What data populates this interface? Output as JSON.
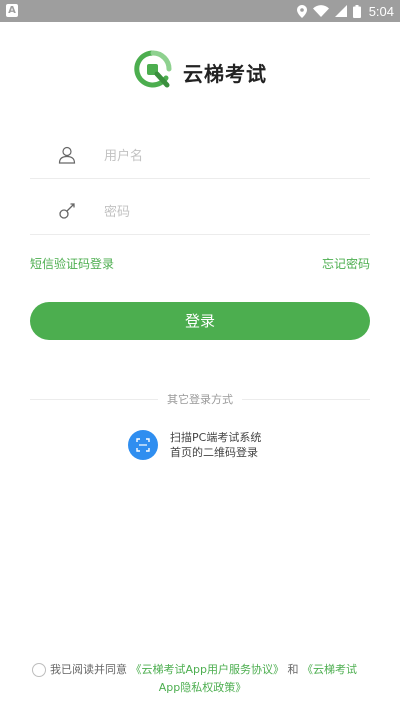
{
  "status_bar": {
    "left_icon": "A",
    "time": "5:04"
  },
  "app": {
    "name": "云梯考试",
    "brand_color": "#4cae4f"
  },
  "form": {
    "username_placeholder": "用户名",
    "password_placeholder": "密码",
    "sms_login_link": "短信验证码登录",
    "forgot_password_link": "忘记密码",
    "login_button": "登录"
  },
  "other_login": {
    "divider_text": "其它登录方式",
    "qr_line1": "扫描PC端考试系统",
    "qr_line2": "首页的二维码登录",
    "icon_color": "#2f8ef0"
  },
  "agreement": {
    "prefix": "我已阅读并同意",
    "service_agreement": "《云梯考试App用户服务协议》",
    "and": "和",
    "privacy_line1": "《云梯考试",
    "privacy_line2": "App隐私权政策》"
  },
  "icons": {
    "status_left": "notification-a-icon",
    "location": "location-icon",
    "wifi": "wifi-icon",
    "signal": "signal-icon",
    "battery": "battery-icon",
    "logo": "yunti-q-logo",
    "user": "user-icon",
    "key": "key-icon",
    "scan": "scan-icon",
    "checkbox": "radio-unchecked-icon"
  }
}
